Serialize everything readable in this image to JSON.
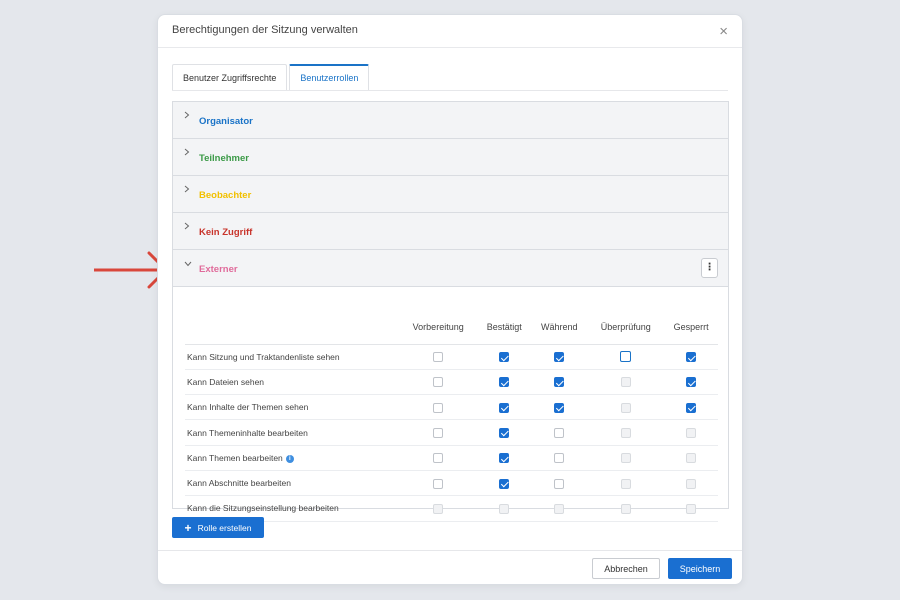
{
  "dialog": {
    "title": "Berechtigungen der Sitzung verwalten",
    "close_glyph": "×"
  },
  "tabs": [
    {
      "label": "Benutzer Zugriffsrechte",
      "active": false
    },
    {
      "label": "Benutzerrollen",
      "active": true
    }
  ],
  "roles": [
    {
      "name": "Organisator",
      "color": "#1a73c7",
      "expanded": false
    },
    {
      "name": "Teilnehmer",
      "color": "#3b9a47",
      "expanded": false
    },
    {
      "name": "Beobachter",
      "color": "#f2c000",
      "expanded": false
    },
    {
      "name": "Kein Zugriff",
      "color": "#c8342b",
      "expanded": false
    },
    {
      "name": "Externer",
      "color": "#e06b9b",
      "expanded": true
    }
  ],
  "more_glyph": "⋮",
  "permissions": {
    "columns": [
      "Vorbereitung",
      "Bestätigt",
      "Während",
      "Überprüfung",
      "Gesperrt"
    ],
    "rows": [
      {
        "label": "Kann Sitzung und Traktandenliste sehen",
        "info": false,
        "states": [
          "empty",
          "checked",
          "checked",
          "focused",
          "checked"
        ]
      },
      {
        "label": "Kann Dateien sehen",
        "info": false,
        "states": [
          "empty",
          "checked",
          "checked",
          "disabled",
          "checked"
        ]
      },
      {
        "label": "Kann Inhalte der Themen sehen",
        "info": false,
        "states": [
          "empty",
          "checked",
          "checked",
          "disabled",
          "checked"
        ]
      },
      {
        "label": "Kann Themeninhalte bearbeiten",
        "info": false,
        "states": [
          "empty",
          "checked",
          "empty",
          "disabled",
          "disabled"
        ]
      },
      {
        "label": "Kann Themen bearbeiten",
        "info": true,
        "states": [
          "empty",
          "checked",
          "empty",
          "disabled",
          "disabled"
        ]
      },
      {
        "label": "Kann Abschnitte bearbeiten",
        "info": false,
        "states": [
          "empty",
          "checked",
          "empty",
          "disabled",
          "disabled"
        ]
      },
      {
        "label": "Kann die Sitzungseinstellung bearbeiten",
        "info": false,
        "states": [
          "disabled",
          "disabled",
          "disabled",
          "disabled",
          "disabled"
        ]
      }
    ]
  },
  "create_role_button": {
    "label": "Rolle erstellen",
    "icon": "+"
  },
  "footer": {
    "cancel_label": "Abbrechen",
    "save_label": "Speichern"
  },
  "colors": {
    "accent": "#1a6fd1",
    "arrow": "#d9473b"
  }
}
